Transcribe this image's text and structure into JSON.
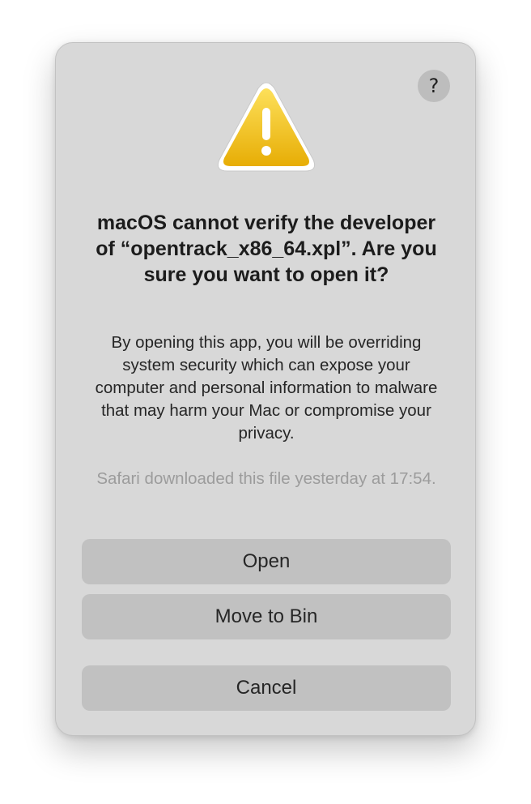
{
  "dialog": {
    "help_label": "?",
    "icon": "warning-triangle-icon",
    "title": "macOS cannot verify the developer of “opentrack_x86_64.xpl”. Are you sure you want to open it?",
    "message": "By opening this app, you will be overriding system security which can expose your computer and personal information to malware that may harm your Mac or compromise your privacy.",
    "download_info": "Safari downloaded this file yesterday at 17:54.",
    "buttons": {
      "open": "Open",
      "move_to_bin": "Move to Bin",
      "cancel": "Cancel"
    }
  },
  "colors": {
    "dialog_background": "#d8d8d8",
    "button_background": "#c1c1c1",
    "warning_yellow": "#f2c21d"
  }
}
